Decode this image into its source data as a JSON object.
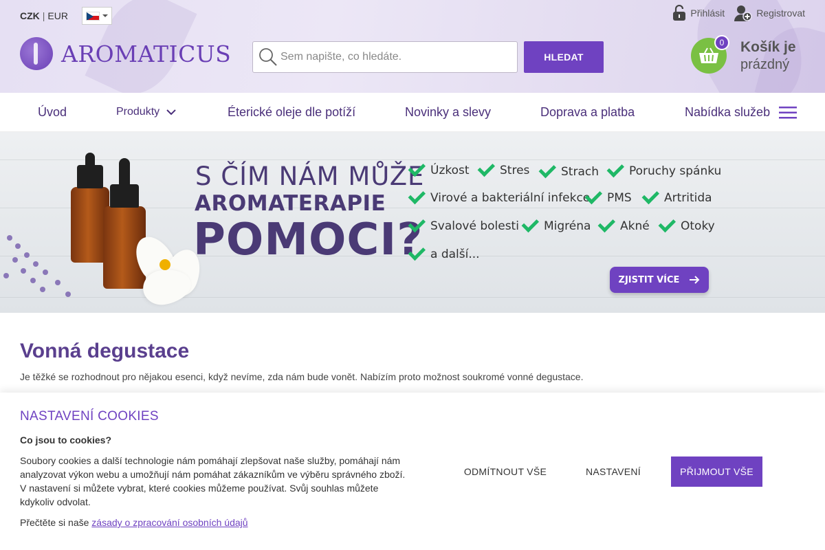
{
  "header": {
    "currency_active": "CZK",
    "currency_separator": "|",
    "currency_other": "EUR",
    "language_flag": "czech-flag-icon",
    "login_label": "Přihlásit",
    "register_label": "Registrovat",
    "logo_text": "AROMATICUS",
    "search_placeholder": "Sem napište, co hledáte.",
    "search_button": "HLEDAT",
    "cart_count": "0",
    "cart_title": "Košík je",
    "cart_subtitle": "prázdný"
  },
  "nav": {
    "items": [
      "Úvod",
      "Produkty",
      "Éterické oleje dle potíží",
      "Novinky a slevy",
      "Doprava a platba",
      "Nabídka služeb"
    ]
  },
  "banner": {
    "line1": "S ČÍM NÁM MŮŽE",
    "line2": "AROMATERAPIE",
    "line3": "POMOCI?",
    "checks": [
      "Úzkost",
      "Stres",
      "Strach",
      "Poruchy spánku",
      "Virové a bakteriální infekce",
      "PMS",
      "Artritida",
      "Svalové bolesti",
      "Migréna",
      "Akné",
      "Otoky",
      "a další..."
    ],
    "button": "ZJISTIT VÍCE"
  },
  "main": {
    "title": "Vonná degustace",
    "description": "Je těžké se rozhodnout pro nějakou esenci, když nevíme, zda nám bude vonět. Nabízím proto možnost soukromé vonné degustace."
  },
  "cookies": {
    "title": "NASTAVENÍ COOKIES",
    "subtitle": "Co jsou to cookies?",
    "body": "Soubory cookies a další technologie nám pomáhají zlepšovat naše služby, pomáhají nám analyzovat výkon webu a umožňují nám pomáhat zákazníkům ve výběru správného zboží. V nastavení si můžete vybrat, které cookies můžeme používat. Svůj souhlas můžete kdykoliv odvolat.",
    "policy_prefix": "Přečtěte si naše",
    "policy_link": "zásady o zpracování osobních údajů",
    "reject": "ODMÍTNOUT VŠE",
    "settings": "NASTAVENÍ",
    "accept": "PŘIJMOUT VŠE"
  },
  "colors": {
    "brand_purple": "#6f42c1",
    "cart_green": "#7ac043",
    "check_green": "#1fb866"
  }
}
